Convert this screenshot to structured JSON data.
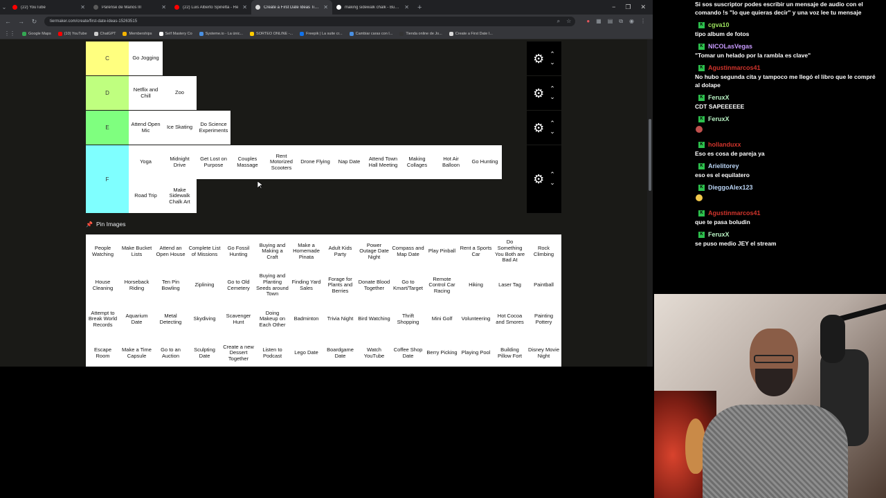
{
  "browser": {
    "tabs": [
      {
        "label": "(22) YouTube",
        "favicon_color": "#ff0000",
        "active": false
      },
      {
        "label": "Parense de Manos III",
        "favicon_color": "#5a5a5a",
        "active": false
      },
      {
        "label": "(22) Luis Alberto Spinetta - Re",
        "favicon_color": "#ff0000",
        "active": false
      },
      {
        "label": "Create a First Date Ideas Tier Li",
        "favicon_color": "#d9d9d9",
        "active": true
      },
      {
        "label": "making sidewalk chalk - Busca",
        "favicon_color": "#ffffff",
        "active": false
      }
    ],
    "url": "tiermaker.com/create/first-date-ideas-15263515",
    "bookmarks": [
      {
        "label": "Google Maps",
        "color": "#34a853"
      },
      {
        "label": "(10) YouTube",
        "color": "#ff0000"
      },
      {
        "label": "ChatGPT",
        "color": "#cccccc"
      },
      {
        "label": "Memberships",
        "color": "#f4b400"
      },
      {
        "label": "Self Mastery Co",
        "color": "#ffffff"
      },
      {
        "label": "Systeme.io - La únic...",
        "color": "#4a90e2"
      },
      {
        "label": "SORTEO ONLINE -...",
        "color": "#ffcc00"
      },
      {
        "label": "Freepik | La suite cr...",
        "color": "#1273eb"
      },
      {
        "label": "Cambiar caras con I...",
        "color": "#4a90e2"
      },
      {
        "label": "Tienda online de Jo...",
        "color": "#333333"
      },
      {
        "label": "Create a First Date I...",
        "color": "#d9d9d9"
      }
    ]
  },
  "tiers": [
    {
      "label": "C",
      "color": "#ffff7f",
      "items": [
        "Go Jogging"
      ]
    },
    {
      "label": "D",
      "color": "#bfff7f",
      "items": [
        "Netflix and Chill",
        "Zoo"
      ]
    },
    {
      "label": "E",
      "color": "#7fff7f",
      "items": [
        "Attend Open Mic",
        "Ice Skating",
        "Do Science Experiments"
      ]
    },
    {
      "label": "F",
      "color": "#7fffff",
      "items": [
        "Yoga",
        "Midnight Drive",
        "Get Lost on Purpose",
        "Couples Massage",
        "Rent Motorized Scooters",
        "Drone Flying",
        "Nap Date",
        "Attend Town Hall Meeting",
        "Making Collages",
        "Hot Air Balloon",
        "Go Hunting",
        "Road Trip",
        "Make Sidewalk Chalk Art"
      ]
    }
  ],
  "pin_images": {
    "title": "Pin Images",
    "items": [
      "People Watching",
      "Make Bucket Lists",
      "Attend an Open House",
      "Complete List of Missions",
      "Go Fossil Hunting",
      "Buying and Making a Craft",
      "Make a Homemade Pinata",
      "Adult Kids Party",
      "Power Outage Date Night",
      "Compass and Map Date",
      "Play Pinball",
      "Rent a Sports Car",
      "Do Something You Both are Bad At",
      "Rock Climbing",
      "House Cleaning",
      "Horseback Riding",
      "Ten Pin Bowling",
      "Ziplining",
      "Go to Old Cemetery",
      "Buying and Planting Seeds around Town",
      "Finding Yard Sales",
      "Forage for Plants and Berries",
      "Donate Blood Together",
      "Go to Kmart/Target",
      "Remote Control Car Racing",
      "Hiking",
      "Laser Tag",
      "Paintball",
      "Attempt to Break World Records",
      "Aquarium Date",
      "Metal Detecting",
      "Skydiving",
      "Scavenger Hunt",
      "Doing Makeup on Each Other",
      "Badminton",
      "Trivia Night",
      "Bird Watching",
      "Thrift Shopping",
      "Mini Golf",
      "Volunteering",
      "Hot Cocoa and Smores",
      "Painting Pottery",
      "Escape Room",
      "Make a Time Capsule",
      "Go to an Auction",
      "Sculpting Date",
      "Create a new Dessert Together",
      "Listen to Podcast",
      "Lego Date",
      "Boardgame Date",
      "Watch YouTube",
      "Coffee Shop Date",
      "Berry Picking",
      "Playing Pool",
      "Building Pillow Fort",
      "Disney Movie Night"
    ]
  },
  "chat": [
    {
      "type": "text",
      "text": "Si sos suscriptor podes escribir un mensaje de audio con el comando !s \"lo que quieras decir\" y una voz lee tu mensaje"
    },
    {
      "type": "user",
      "name": "cgva10",
      "color": "#9be15d"
    },
    {
      "type": "text",
      "text": "tipo album de fotos"
    },
    {
      "type": "user",
      "name": "NICOLasVegas",
      "color": "#c99bff"
    },
    {
      "type": "text",
      "text": "\"Tomar un helado por la rambla es clave\""
    },
    {
      "type": "user",
      "name": "Agustinmarcos41",
      "color": "#d0342c"
    },
    {
      "type": "text",
      "text": "No hubo segunda cita y tampoco me llegó el libro que le compré al dolape"
    },
    {
      "type": "user",
      "name": "FeruxX",
      "color": "#b9f3c4"
    },
    {
      "type": "text",
      "text": "CDT SAPEEEEEE"
    },
    {
      "type": "user",
      "name": "FeruxX",
      "color": "#b9f3c4"
    },
    {
      "type": "emote",
      "color": "#c0504d"
    },
    {
      "type": "user",
      "name": "hollanduxx",
      "color": "#d0342c"
    },
    {
      "type": "text",
      "text": "Eso es cosa de pareja ya"
    },
    {
      "type": "user",
      "name": "Arielitorey",
      "color": "#b9d3f3"
    },
    {
      "type": "text",
      "text": "eso es el equilatero"
    },
    {
      "type": "user",
      "name": "DieggoAlex123",
      "color": "#b9d3f3"
    },
    {
      "type": "emote",
      "color": "#f2c94c"
    },
    {
      "type": "user",
      "name": "Agustinmarcos41",
      "color": "#d0342c"
    },
    {
      "type": "text",
      "text": "que te pasa boludin"
    },
    {
      "type": "user",
      "name": "FeruxX",
      "color": "#b9f3c4"
    },
    {
      "type": "text",
      "text": "se puso medio JEY el stream"
    }
  ]
}
